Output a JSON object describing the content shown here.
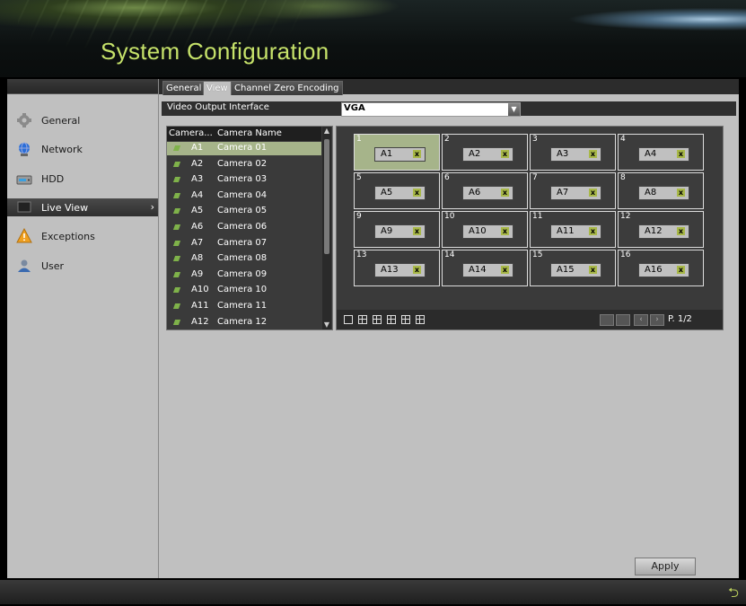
{
  "window": {
    "title": "System Configuration"
  },
  "sidebar": {
    "items": [
      {
        "label": "General",
        "icon": "wrench-icon"
      },
      {
        "label": "Network",
        "icon": "network-globe-icon"
      },
      {
        "label": "HDD",
        "icon": "hdd-icon"
      },
      {
        "label": "Live View",
        "icon": "monitor-icon",
        "active": true
      },
      {
        "label": "Exceptions",
        "icon": "warning-icon"
      },
      {
        "label": "User",
        "icon": "user-icon"
      }
    ],
    "active_chevron": "›"
  },
  "tabs": [
    {
      "label": "General"
    },
    {
      "label": "View",
      "active": true
    },
    {
      "label": "Channel Zero Encoding"
    }
  ],
  "video_output": {
    "label": "Video Output Interface",
    "value": "VGA"
  },
  "camera_list": {
    "headers": [
      "Camera...",
      "Camera Name"
    ],
    "rows": [
      {
        "id": "A1",
        "name": "Camera 01"
      },
      {
        "id": "A2",
        "name": "Camera 02"
      },
      {
        "id": "A3",
        "name": "Camera 03"
      },
      {
        "id": "A4",
        "name": "Camera 04"
      },
      {
        "id": "A5",
        "name": "Camera 05"
      },
      {
        "id": "A6",
        "name": "Camera 06"
      },
      {
        "id": "A7",
        "name": "Camera 07"
      },
      {
        "id": "A8",
        "name": "Camera 08"
      },
      {
        "id": "A9",
        "name": "Camera 09"
      },
      {
        "id": "A10",
        "name": "Camera 10"
      },
      {
        "id": "A11",
        "name": "Camera 11"
      },
      {
        "id": "A12",
        "name": "Camera 12"
      }
    ],
    "selected_index": 0
  },
  "view_grid": {
    "cells": [
      {
        "no": "1",
        "cam": "A1"
      },
      {
        "no": "2",
        "cam": "A2"
      },
      {
        "no": "3",
        "cam": "A3"
      },
      {
        "no": "4",
        "cam": "A4"
      },
      {
        "no": "5",
        "cam": "A5"
      },
      {
        "no": "6",
        "cam": "A6"
      },
      {
        "no": "7",
        "cam": "A7"
      },
      {
        "no": "8",
        "cam": "A8"
      },
      {
        "no": "9",
        "cam": "A9"
      },
      {
        "no": "10",
        "cam": "A10"
      },
      {
        "no": "11",
        "cam": "A11"
      },
      {
        "no": "12",
        "cam": "A12"
      },
      {
        "no": "13",
        "cam": "A13"
      },
      {
        "no": "14",
        "cam": "A14"
      },
      {
        "no": "15",
        "cam": "A15"
      },
      {
        "no": "16",
        "cam": "A16"
      }
    ],
    "selected_index": 0,
    "remove_glyph": "x",
    "pager": "P. 1/2"
  },
  "actions": {
    "apply": "Apply"
  }
}
